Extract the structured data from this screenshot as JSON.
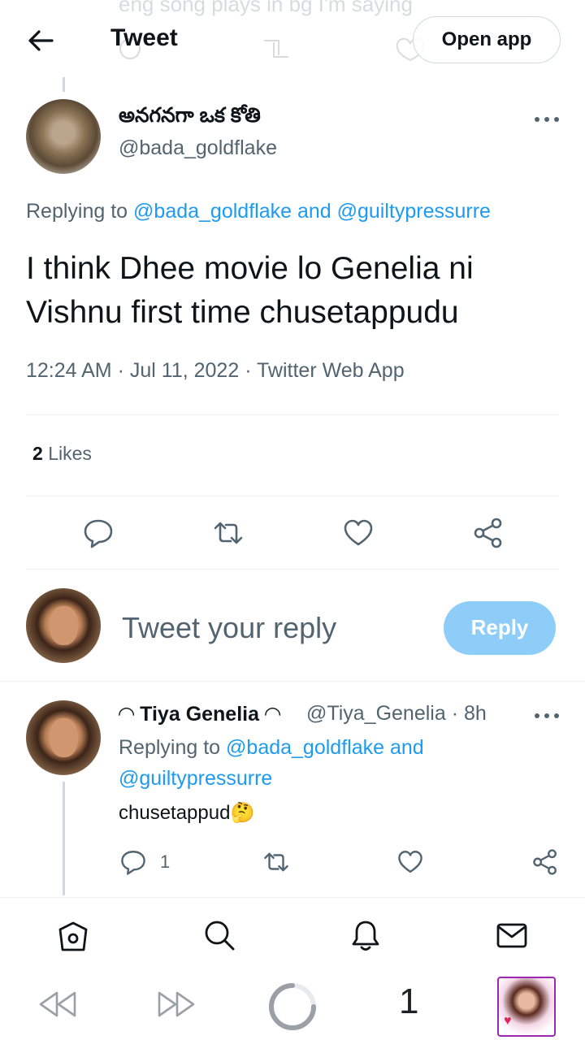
{
  "background_text": "eng song plays in bg I'm saying",
  "header": {
    "title": "Tweet",
    "open_app_label": "Open app"
  },
  "tweet": {
    "author_name": "అనగనగా ఒక కోతి",
    "author_handle": "@bada_goldflake",
    "replying_prefix": "Replying to",
    "replying_links": "@bada_goldflake and @guiltypressurre",
    "text": "I think Dhee movie lo Genelia ni Vishnu first time chusetappudu",
    "time": "12:24 AM",
    "date": "Jul 11, 2022",
    "source": "Twitter Web App",
    "likes_count": "2",
    "likes_label": "Likes"
  },
  "compose": {
    "placeholder": "Tweet your reply",
    "button_label": "Reply"
  },
  "reply": {
    "name": "◠ Tiya Genelia ◠",
    "handle_time": "@Tiya_Genelia · 8h",
    "replying_prefix": "Replying to",
    "replying_line1_link": "@bada_goldflake and",
    "replying_line2_link": "@guiltypressurre",
    "text": "chusetappud🤔",
    "reply_count": "1"
  },
  "browser": {
    "tab_count": "1"
  },
  "colors": {
    "accent": "#1d9bf0",
    "reply_button": "#8ecdf8",
    "secondary_text": "#536471",
    "tab_border": "#9c27b0"
  },
  "icons": [
    "back-arrow-icon",
    "more-icon",
    "reply-icon",
    "retweet-icon",
    "like-icon",
    "share-icon",
    "home-icon",
    "search-icon",
    "notifications-icon",
    "messages-icon",
    "rewind-icon",
    "fast-forward-icon",
    "loading-icon"
  ]
}
